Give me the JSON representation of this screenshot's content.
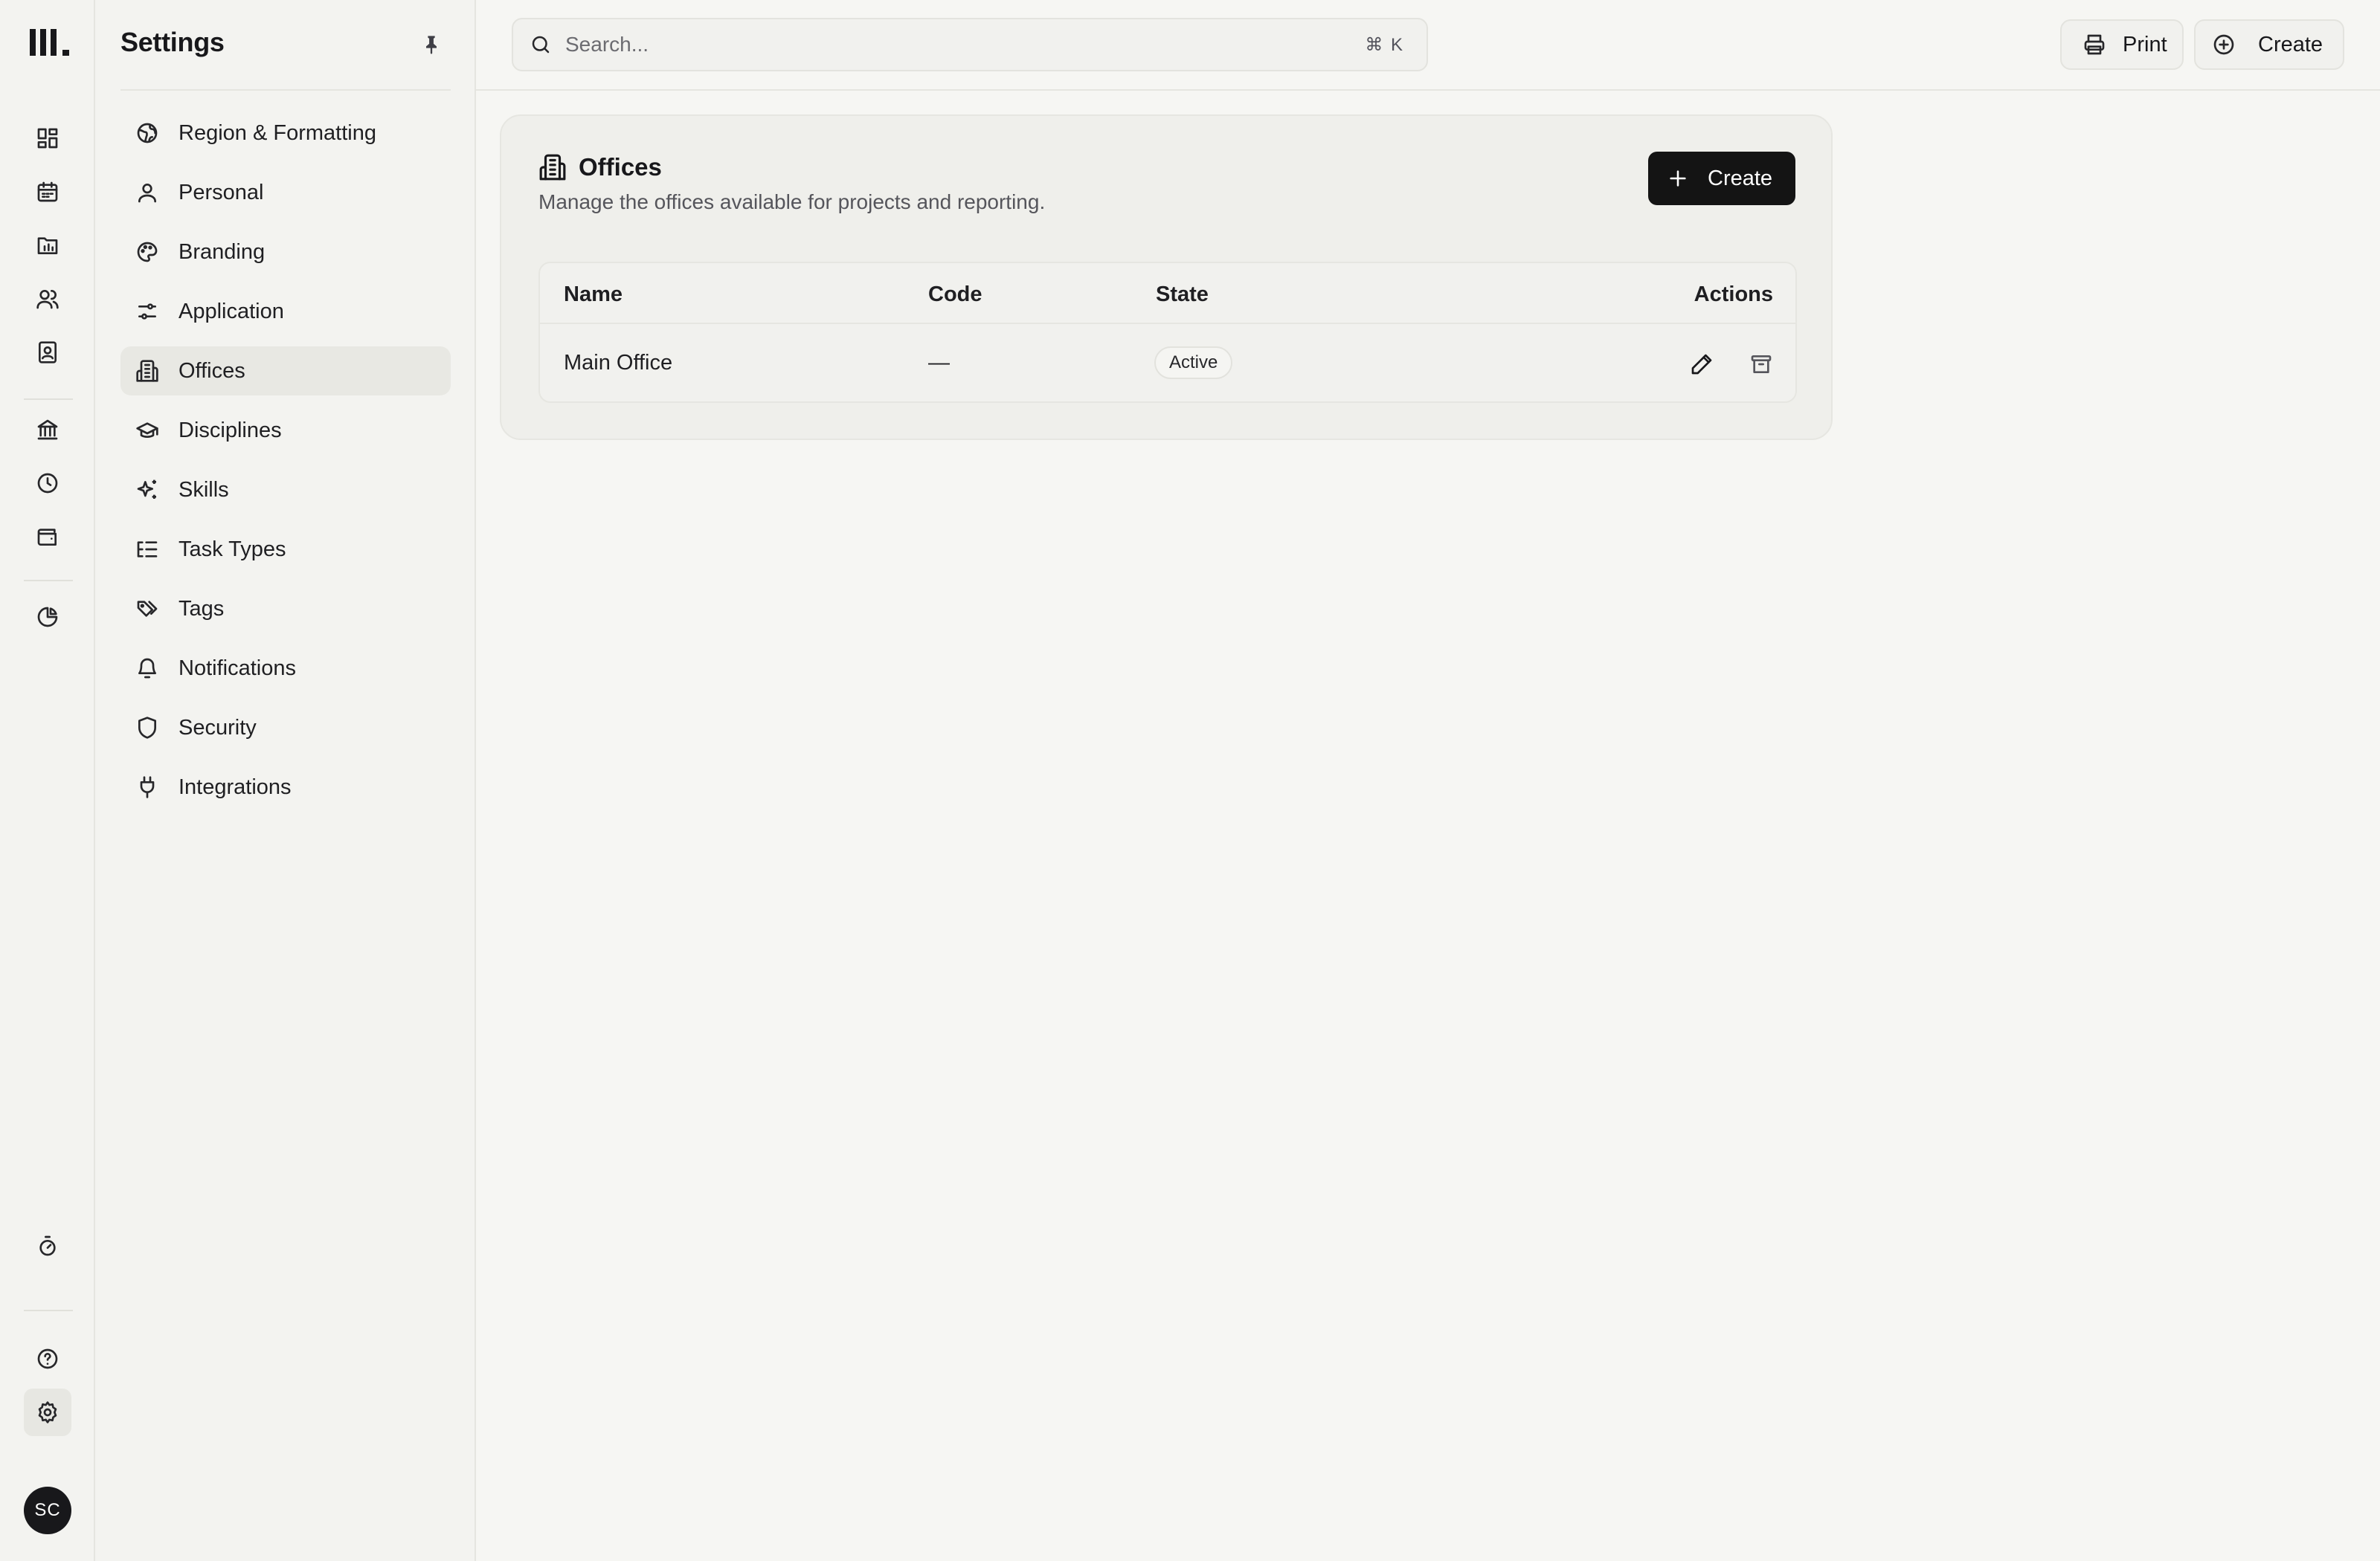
{
  "sidebar": {
    "title": "Settings",
    "items": [
      {
        "label": "Region & Formatting",
        "icon": "globe-icon"
      },
      {
        "label": "Personal",
        "icon": "user-icon"
      },
      {
        "label": "Branding",
        "icon": "palette-icon"
      },
      {
        "label": "Application",
        "icon": "sliders-icon"
      },
      {
        "label": "Offices",
        "icon": "building-icon",
        "active": true
      },
      {
        "label": "Disciplines",
        "icon": "graduation-cap-icon"
      },
      {
        "label": "Skills",
        "icon": "sparkles-icon"
      },
      {
        "label": "Task Types",
        "icon": "list-tree-icon"
      },
      {
        "label": "Tags",
        "icon": "tags-icon"
      },
      {
        "label": "Notifications",
        "icon": "bell-icon"
      },
      {
        "label": "Security",
        "icon": "shield-icon"
      },
      {
        "label": "Integrations",
        "icon": "plug-icon"
      }
    ]
  },
  "rail": {
    "icons": [
      "dashboard-icon",
      "calendar-icon",
      "chart-folder-icon",
      "users-icon",
      "contacts-icon",
      "bank-icon",
      "clock-icon",
      "wallet-icon",
      "pie-chart-icon",
      "timer-icon",
      "help-icon",
      "settings-icon"
    ],
    "avatar_initials": "SC"
  },
  "topbar": {
    "search_placeholder": "Search...",
    "search_shortcut": "⌘ K",
    "print_label": "Print",
    "create_label": "Create"
  },
  "card": {
    "title": "Offices",
    "description": "Manage the offices available for projects and reporting.",
    "create_label": "Create",
    "columns": {
      "name": "Name",
      "code": "Code",
      "state": "State",
      "actions": "Actions"
    },
    "rows": [
      {
        "name": "Main Office",
        "code": "—",
        "state": "Active"
      }
    ]
  },
  "colors": {
    "accent_dark": "#141414",
    "background": "#f6f6f3"
  }
}
